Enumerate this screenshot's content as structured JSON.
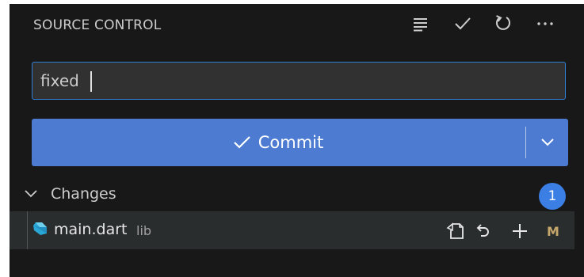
{
  "header": {
    "title": "SOURCE CONTROL",
    "actions": [
      {
        "icon": "list-view-icon"
      },
      {
        "icon": "check-icon"
      },
      {
        "icon": "refresh-icon"
      },
      {
        "icon": "more-icon"
      }
    ]
  },
  "message_input": {
    "value": "fixed",
    "placeholder": ""
  },
  "commit_button": {
    "label": "Commit",
    "icon": "check-icon",
    "dropdown_icon": "chevron-down-icon"
  },
  "changes": {
    "label": "Changes",
    "count": "1",
    "files": [
      {
        "name": "main.dart",
        "dir": "lib",
        "status": "M",
        "icon": "dart-file-icon",
        "actions": [
          "open-file-icon",
          "discard-changes-icon",
          "stage-changes-icon"
        ]
      }
    ]
  },
  "colors": {
    "panel_bg": "#181818",
    "accent": "#4c7bd1",
    "badge": "#3b7ee4",
    "modified": "#c5a66b",
    "input_border": "#2f7fd6"
  }
}
